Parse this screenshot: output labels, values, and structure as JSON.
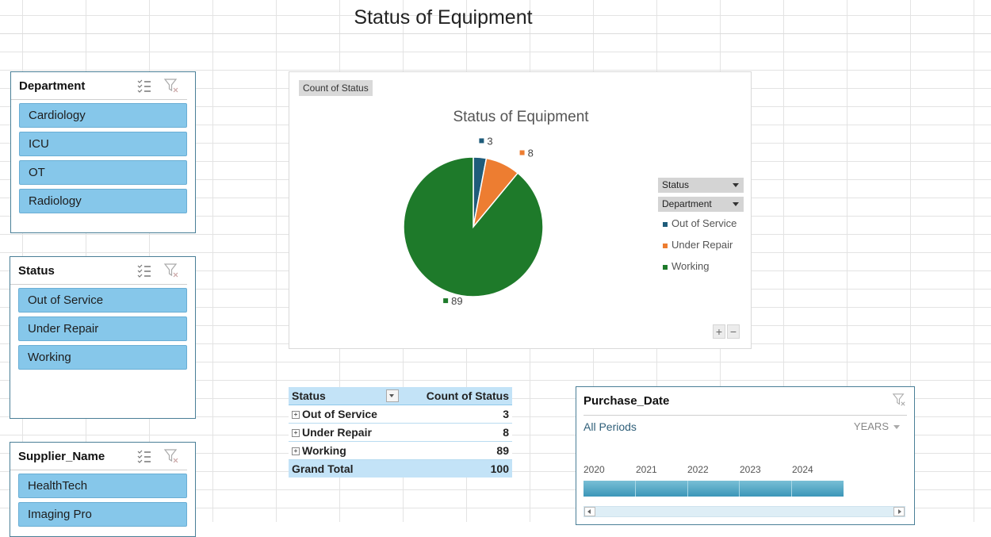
{
  "dashboard_title": "Status of Equipment",
  "slicers": {
    "department": {
      "title": "Department",
      "items": [
        "Cardiology",
        "ICU",
        "OT",
        "Radiology"
      ]
    },
    "status": {
      "title": "Status",
      "items": [
        "Out of Service",
        "Under Repair",
        "Working"
      ]
    },
    "supplier": {
      "title": "Supplier_Name",
      "items": [
        "HealthTech",
        "Imaging Pro"
      ]
    }
  },
  "chart": {
    "field_button": "Count of Status",
    "legend_fields": [
      "Status",
      "Department"
    ],
    "colors": {
      "Out of Service": "#1f5c7a",
      "Under Repair": "#ed7d31",
      "Working": "#1e7a2a"
    }
  },
  "chart_data": {
    "type": "pie",
    "title": "Status of Equipment",
    "categories": [
      "Out of Service",
      "Under Repair",
      "Working"
    ],
    "values": [
      3,
      8,
      89
    ],
    "legend_position": "right"
  },
  "pivot": {
    "headers": [
      "Status",
      "Count of Status"
    ],
    "rows": [
      {
        "label": "Out of Service",
        "value": "3"
      },
      {
        "label": "Under Repair",
        "value": "8"
      },
      {
        "label": "Working",
        "value": "89"
      }
    ],
    "total_label": "Grand Total",
    "total_value": "100"
  },
  "timeline": {
    "title": "Purchase_Date",
    "all_periods": "All Periods",
    "level": "YEARS",
    "years": [
      "2020",
      "2021",
      "2022",
      "2023",
      "2024"
    ]
  }
}
